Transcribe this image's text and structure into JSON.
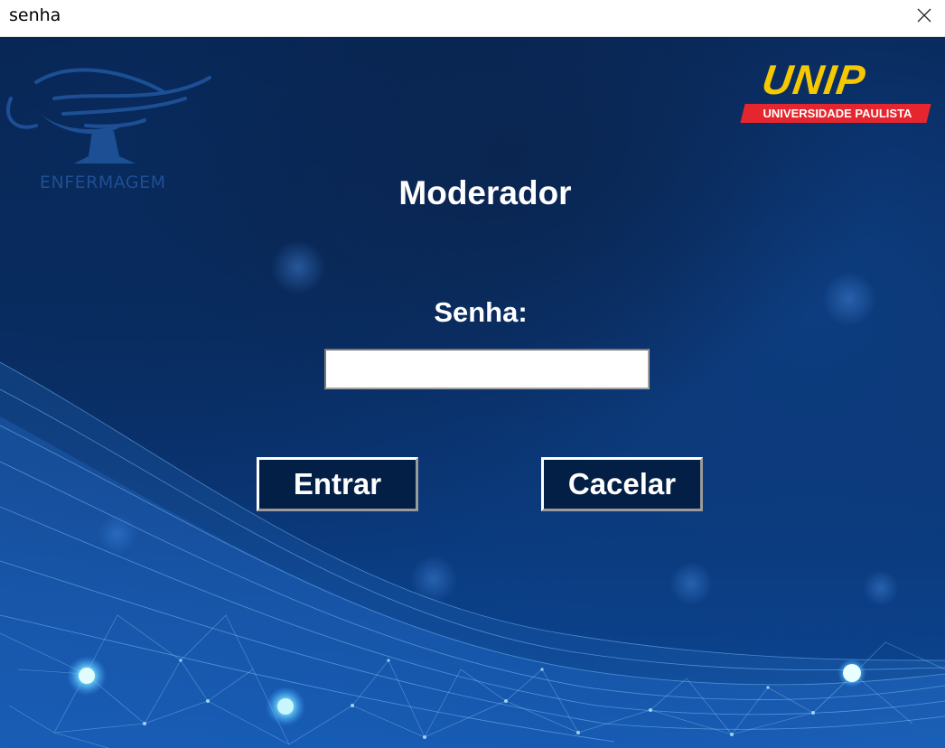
{
  "window": {
    "title": "senha",
    "close_icon": "close-icon"
  },
  "logos": {
    "left_logo_icon": "nursing-lamp-icon",
    "left_logo_text": "ENFERMAGEM",
    "right_logo_word": "UNIP",
    "right_logo_subtitle": "UNIVERSIDADE PAULISTA"
  },
  "form": {
    "heading": "Moderador",
    "password_label": "Senha:",
    "password_value": "",
    "enter_button": "Entrar",
    "cancel_button": "Cacelar"
  },
  "colors": {
    "background_dark": "#07204a",
    "background_light": "#0b4a9a",
    "unip_yellow": "#f6c800",
    "unip_red": "#e5262e",
    "button_fill": "#041f45",
    "text": "#ffffff"
  }
}
